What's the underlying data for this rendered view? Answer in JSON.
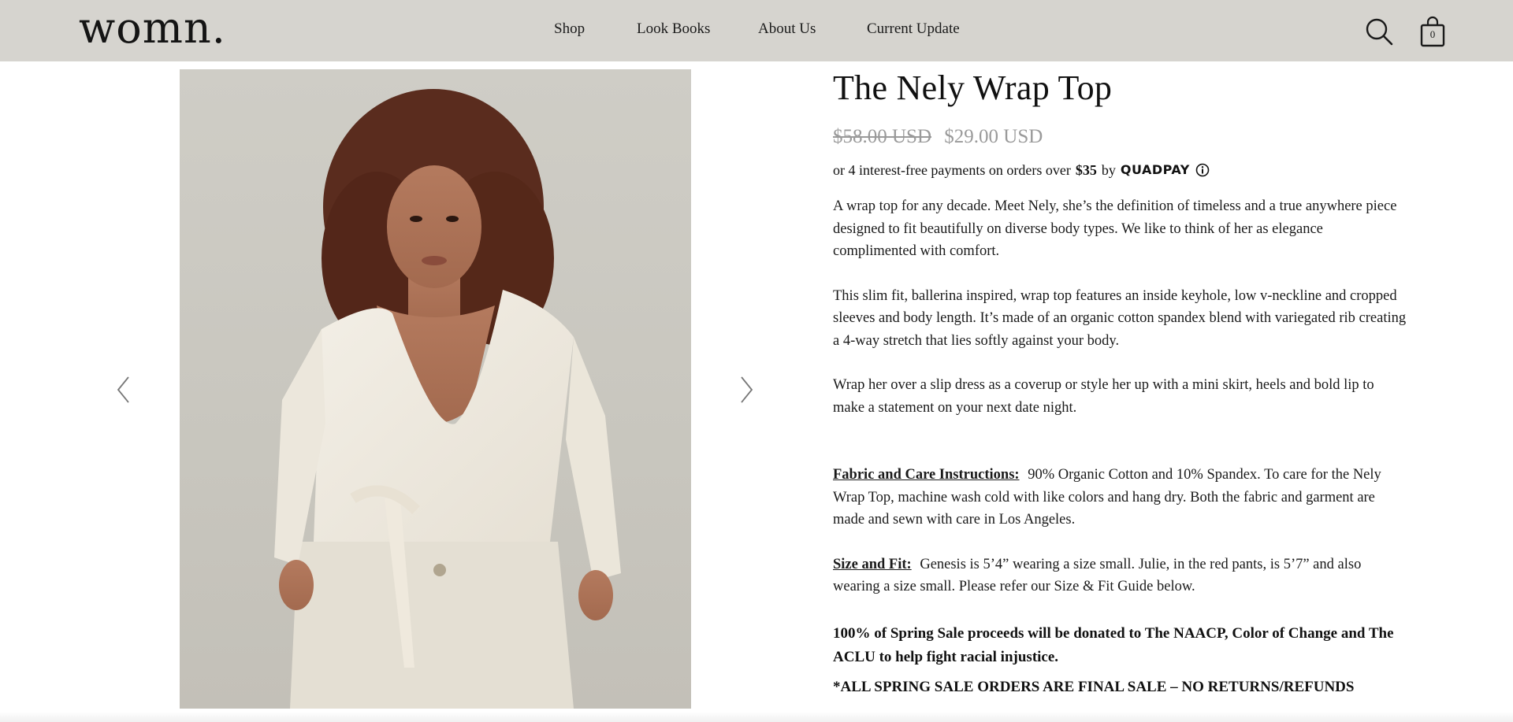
{
  "header": {
    "logo": "womn.",
    "nav": [
      {
        "label": "Shop"
      },
      {
        "label": "Look Books"
      },
      {
        "label": "About Us"
      },
      {
        "label": "Current Update"
      }
    ],
    "search_icon": "search-icon",
    "cart_icon": "shopping-bag-icon",
    "cart_count": "0",
    "background_color": "#d6d4cf"
  },
  "gallery": {
    "prev_icon": "chevron-left-icon",
    "next_icon": "chevron-right-icon"
  },
  "product": {
    "title": "The Nely Wrap Top",
    "price_original": "$58.00 USD",
    "price_sale": "$29.00 USD",
    "quadpay": {
      "text_before": "or 4 interest-free payments on orders over",
      "threshold": "$35",
      "text_by": "by",
      "brand": "QUADPAY",
      "info_icon": "info-circle-icon"
    },
    "description": [
      "A wrap top for any decade. Meet Nely, she’s the definition of timeless and a true anywhere piece designed to fit beautifully on diverse body types. We like to think of her as elegance complimented with comfort.",
      "This slim fit, ballerina inspired, wrap top features an inside keyhole, low v-neckline and cropped sleeves and body length. It’s made of an organic cotton spandex blend with variegated rib creating a 4-way stretch that lies softly against your body.",
      "Wrap her over a slip dress as a coverup or style her up with a mini skirt, heels and bold lip to make a statement on your next date night."
    ],
    "fabric": {
      "label": "Fabric and Care Instructions:",
      "text": "90% Organic Cotton and 10% Spandex. To care for the Nely Wrap Top, machine wash cold with like colors and hang dry. Both the fabric and garment are made and sewn with care in Los Angeles."
    },
    "size_fit": {
      "label": "Size and Fit:",
      "text": "Genesis is 5’4” wearing a size small. Julie, in the red pants, is 5’7” and also wearing a size small. Please refer our Size & Fit Guide below."
    },
    "notice": "100% of Spring Sale proceeds will be donated to The NAACP, Color of Change and The ACLU to help fight racial injustice.",
    "final_sale": "*ALL SPRING SALE ORDERS ARE FINAL SALE – NO RETURNS/REFUNDS"
  }
}
